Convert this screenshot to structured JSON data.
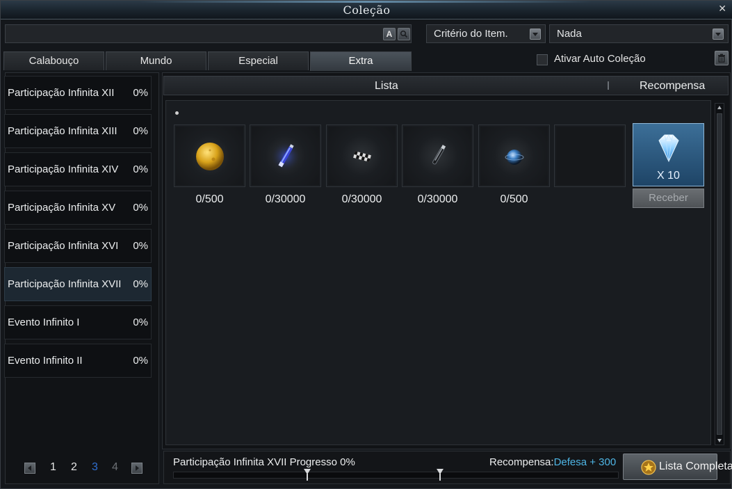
{
  "window": {
    "title": "Coleção"
  },
  "search": {
    "value": "",
    "placeholder": ""
  },
  "filters": {
    "criteria": "Critério do Item.",
    "value": "Nada"
  },
  "tabs": [
    "Calabouço",
    "Mundo",
    "Especial",
    "Extra"
  ],
  "active_tab": "Extra",
  "auto_collect": {
    "label": "Ativar Auto Coleção",
    "checked": false
  },
  "categories": [
    {
      "name": "Participação Infinita XII",
      "pct": "0%"
    },
    {
      "name": "Participação Infinita XIII",
      "pct": "0%"
    },
    {
      "name": "Participação Infinita XIV",
      "pct": "0%"
    },
    {
      "name": "Participação Infinita XV",
      "pct": "0%"
    },
    {
      "name": "Participação Infinita XVI",
      "pct": "0%"
    },
    {
      "name": "Participação Infinita XVII",
      "pct": "0%"
    },
    {
      "name": "Evento Infinito I",
      "pct": "0%"
    },
    {
      "name": "Evento Infinito II",
      "pct": "0%"
    }
  ],
  "selected_category": "Participação Infinita XVII",
  "pagination": {
    "pages": [
      "1",
      "2",
      "3",
      "4"
    ],
    "current": "3"
  },
  "columns": {
    "list": "Lista",
    "reward": "Recompensa"
  },
  "items": [
    {
      "icon": "gold-orb-icon",
      "count": "0/500"
    },
    {
      "icon": "blue-vial-icon",
      "count": "0/30000"
    },
    {
      "icon": "checkered-flag-icon",
      "count": "0/30000"
    },
    {
      "icon": "dark-vial-icon",
      "count": "0/30000"
    },
    {
      "icon": "blue-sphere-icon",
      "count": "0/500"
    },
    {
      "icon": "empty-slot",
      "count": ""
    }
  ],
  "reward": {
    "icon": "diamond-icon",
    "qty": "X 10",
    "button": "Receber"
  },
  "progress": {
    "label": "Participação Infinita XVII Progresso 0%",
    "value": 0
  },
  "reward_summary": {
    "label": "Recompensa:",
    "value": "Defesa + 300"
  },
  "full_list_button": "Lista Completa",
  "colors": {
    "accent": "#4fb6e6",
    "current_page": "#2f6fd0",
    "selected_row": "#1d2832"
  }
}
